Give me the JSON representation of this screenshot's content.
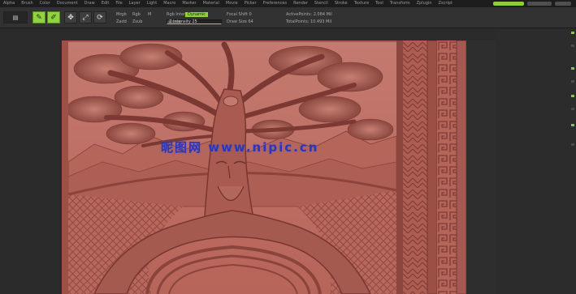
{
  "menu": {
    "items": [
      "Alpha",
      "Brush",
      "Color",
      "Document",
      "Draw",
      "Edit",
      "File",
      "Layer",
      "Light",
      "Macro",
      "Marker",
      "Material",
      "Movie",
      "Picker",
      "Preferences",
      "Render",
      "Stencil",
      "Stroke",
      "Texture",
      "Tool",
      "Transform",
      "Zplugin",
      "Zscript"
    ],
    "right_label": "QuickSave"
  },
  "shelf": {
    "buttons": [
      {
        "icon": "edit-icon",
        "glyph": "✎"
      },
      {
        "icon": "draw-icon",
        "glyph": "✐"
      },
      {
        "icon": "move-icon",
        "glyph": "✥"
      },
      {
        "icon": "scale-icon",
        "glyph": "⤢"
      },
      {
        "icon": "rotate-icon",
        "glyph": "⟳"
      }
    ],
    "labels": {
      "mrgb": "Mrgb",
      "rgb": "Rgb",
      "m": "M",
      "zadd": "Zadd",
      "zsub": "Zsub",
      "focal": "Focal Shift 0",
      "draw_size": "Draw Size 64",
      "dynamic": "Dynamic",
      "rgb_intensity": "Rgb Intensity 100",
      "z_intensity": "Z Intensity 25",
      "active_points": "ActivePoints: 2.084 Mil",
      "total_points": "TotalPoints: 10.493 Mil"
    },
    "z_intensity_level": 0.25,
    "rgb_intensity_level": 1.0
  },
  "canvas": {
    "watermark": "昵图网 www.nipic.cn",
    "model_color": "#b9695f"
  },
  "colors": {
    "accent": "#8fd43c",
    "background": "#2b2b2b",
    "clay": "#b9695f"
  }
}
